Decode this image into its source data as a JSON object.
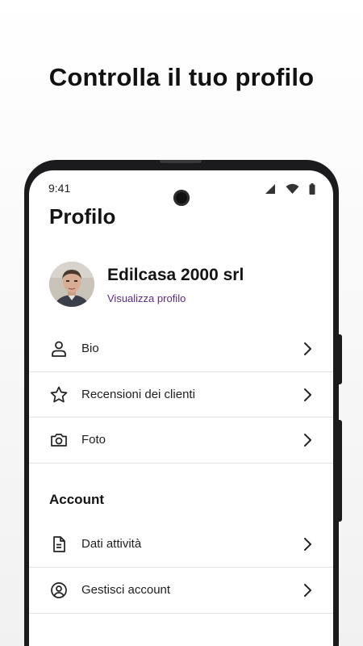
{
  "headline": "Controlla il tuo profilo",
  "status_bar": {
    "time": "9:41",
    "icons": [
      "signal-icon",
      "wifi-icon",
      "battery-icon"
    ]
  },
  "screen": {
    "title": "Profilo"
  },
  "profile": {
    "name": "Edilcasa 2000 srl",
    "link_label": "Visualizza profilo"
  },
  "menu": [
    {
      "label": "Bio",
      "icon": "person-icon"
    },
    {
      "label": "Recensioni dei clienti",
      "icon": "star-icon"
    },
    {
      "label": "Foto",
      "icon": "camera-icon"
    }
  ],
  "account": {
    "title": "Account",
    "items": [
      {
        "label": "Dati attività",
        "icon": "document-icon"
      },
      {
        "label": "Gestisci account",
        "icon": "user-circle-icon"
      }
    ]
  },
  "colors": {
    "accent": "#5b2a86",
    "text": "#141414",
    "divider": "#e2e2e2",
    "phone_frame": "#1b1b1d"
  }
}
